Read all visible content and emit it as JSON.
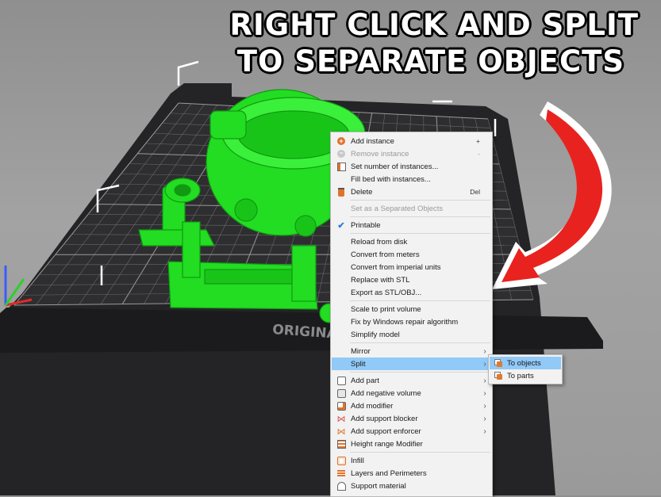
{
  "headline": {
    "line1": "RIGHT CLICK AND SPLIT",
    "line2": "TO SEPARATE OBJECTS"
  },
  "bed": {
    "brand_text": "ORIGINA"
  },
  "colors": {
    "model": "#22dd22",
    "bed": "#2b2b2d",
    "arrow": "#e8231f",
    "menu_highlight": "#91c9f7"
  },
  "context_menu": {
    "items": [
      {
        "label": "Add instance",
        "shortcut": "+",
        "icon": "plus-circle-icon",
        "disabled": false,
        "submenu": false,
        "highlighted": false
      },
      {
        "label": "Remove instance",
        "shortcut": "-",
        "icon": "minus-circle-icon",
        "disabled": true,
        "submenu": false,
        "highlighted": false
      },
      {
        "label": "Set number of instances...",
        "shortcut": "",
        "icon": "instances-icon",
        "disabled": false,
        "submenu": false,
        "highlighted": false
      },
      {
        "label": "Fill bed with instances...",
        "shortcut": "",
        "icon": "",
        "disabled": false,
        "submenu": false,
        "highlighted": false
      },
      {
        "label": "Delete",
        "shortcut": "Del",
        "icon": "trash-icon",
        "disabled": false,
        "submenu": false,
        "highlighted": false
      },
      {
        "label": "Set as a Separated Objects",
        "shortcut": "",
        "icon": "",
        "disabled": true,
        "submenu": false,
        "highlighted": false
      },
      {
        "label": "Printable",
        "shortcut": "",
        "icon": "check-icon",
        "disabled": false,
        "submenu": false,
        "highlighted": false
      },
      {
        "label": "Reload from disk",
        "shortcut": "",
        "icon": "",
        "disabled": false,
        "submenu": false,
        "highlighted": false
      },
      {
        "label": "Convert from meters",
        "shortcut": "",
        "icon": "",
        "disabled": false,
        "submenu": false,
        "highlighted": false
      },
      {
        "label": "Convert from imperial units",
        "shortcut": "",
        "icon": "",
        "disabled": false,
        "submenu": false,
        "highlighted": false
      },
      {
        "label": "Replace with STL",
        "shortcut": "",
        "icon": "",
        "disabled": false,
        "submenu": false,
        "highlighted": false
      },
      {
        "label": "Export as STL/OBJ...",
        "shortcut": "",
        "icon": "",
        "disabled": false,
        "submenu": false,
        "highlighted": false
      },
      {
        "label": "Scale to print volume",
        "shortcut": "",
        "icon": "",
        "disabled": false,
        "submenu": false,
        "highlighted": false
      },
      {
        "label": "Fix by Windows repair algorithm",
        "shortcut": "",
        "icon": "",
        "disabled": false,
        "submenu": false,
        "highlighted": false
      },
      {
        "label": "Simplify model",
        "shortcut": "",
        "icon": "",
        "disabled": false,
        "submenu": false,
        "highlighted": false
      },
      {
        "label": "Mirror",
        "shortcut": "",
        "icon": "",
        "disabled": false,
        "submenu": true,
        "highlighted": false
      },
      {
        "label": "Split",
        "shortcut": "",
        "icon": "",
        "disabled": false,
        "submenu": true,
        "highlighted": true
      },
      {
        "label": "Add part",
        "shortcut": "",
        "icon": "add-part-icon",
        "disabled": false,
        "submenu": true,
        "highlighted": false
      },
      {
        "label": "Add negative volume",
        "shortcut": "",
        "icon": "negative-volume-icon",
        "disabled": false,
        "submenu": true,
        "highlighted": false
      },
      {
        "label": "Add modifier",
        "shortcut": "",
        "icon": "modifier-icon",
        "disabled": false,
        "submenu": true,
        "highlighted": false
      },
      {
        "label": "Add support blocker",
        "shortcut": "",
        "icon": "support-blocker-icon",
        "disabled": false,
        "submenu": true,
        "highlighted": false
      },
      {
        "label": "Add support enforcer",
        "shortcut": "",
        "icon": "support-enforcer-icon",
        "disabled": false,
        "submenu": true,
        "highlighted": false
      },
      {
        "label": "Height range Modifier",
        "shortcut": "",
        "icon": "height-range-icon",
        "disabled": false,
        "submenu": false,
        "highlighted": false
      },
      {
        "label": "Infill",
        "shortcut": "",
        "icon": "infill-icon",
        "disabled": false,
        "submenu": false,
        "highlighted": false
      },
      {
        "label": "Layers and Perimeters",
        "shortcut": "",
        "icon": "layers-icon",
        "disabled": false,
        "submenu": false,
        "highlighted": false
      },
      {
        "label": "Support material",
        "shortcut": "",
        "icon": "support-material-icon",
        "disabled": false,
        "submenu": false,
        "highlighted": false
      }
    ]
  },
  "split_submenu": {
    "items": [
      {
        "label": "To objects",
        "icon": "split-objects-icon",
        "highlighted": true
      },
      {
        "label": "To parts",
        "icon": "split-parts-icon",
        "highlighted": false
      }
    ]
  }
}
